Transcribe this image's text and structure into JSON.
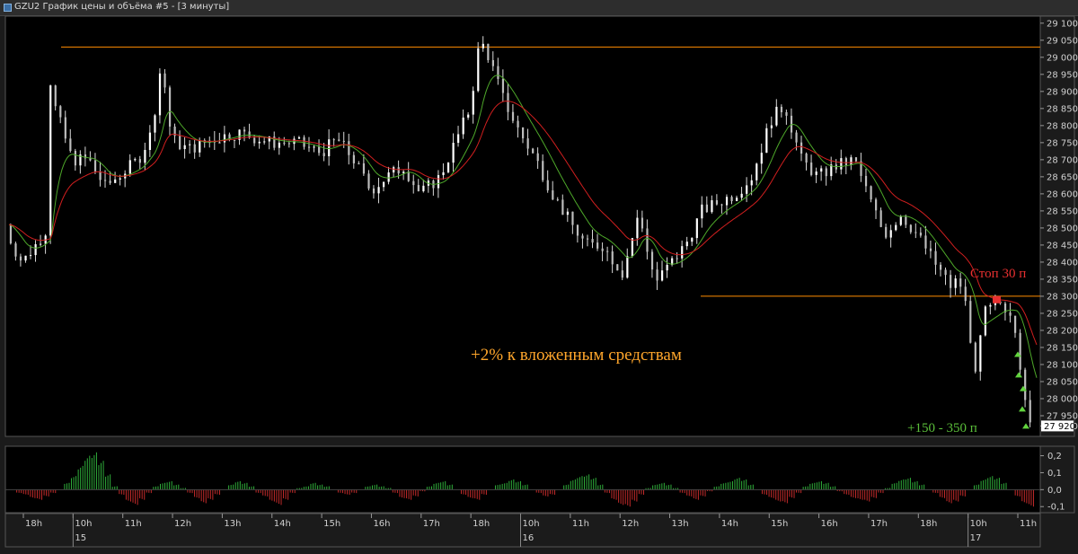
{
  "window": {
    "title": "GZU2 График цены и объёма #5 - [3 минуты]"
  },
  "chart_data": [
    {
      "type": "candlestick",
      "ylim": [
        27900,
        29110
      ],
      "y_ticks": [
        "29 100",
        "29 050",
        "29 000",
        "28 950",
        "28 900",
        "28 850",
        "28 800",
        "28 750",
        "28 700",
        "28 650",
        "28 600",
        "28 550",
        "28 500",
        "28 450",
        "28 400",
        "28 350",
        "28 300",
        "28 250",
        "28 200",
        "28 150",
        "28 100",
        "28 050",
        "28 000",
        "27 950",
        "27 920"
      ],
      "current_price_label": "27 920",
      "x_ticks": [
        "18h",
        "10h",
        "11h",
        "12h",
        "13h",
        "14h",
        "15h",
        "16h",
        "17h",
        "18h",
        "10h",
        "11h",
        "12h",
        "13h",
        "14h",
        "15h",
        "16h",
        "17h",
        "18h",
        "10h",
        "11h"
      ],
      "date_labels": [
        {
          "text": "15",
          "at": "10h"
        },
        {
          "text": "16",
          "at": "10h"
        },
        {
          "text": "17",
          "at": "10h"
        }
      ],
      "price_path": [
        [
          0,
          28510
        ],
        [
          4,
          28450
        ],
        [
          10,
          28400
        ],
        [
          18,
          28450
        ],
        [
          25,
          28500
        ],
        [
          27,
          28930
        ],
        [
          30,
          28850
        ],
        [
          40,
          28700
        ],
        [
          50,
          28700
        ],
        [
          60,
          28620
        ],
        [
          70,
          28660
        ],
        [
          80,
          28700
        ],
        [
          88,
          28780
        ],
        [
          94,
          28990
        ],
        [
          100,
          28760
        ],
        [
          110,
          28730
        ],
        [
          125,
          28760
        ],
        [
          140,
          28780
        ],
        [
          160,
          28750
        ],
        [
          175,
          28750
        ],
        [
          190,
          28720
        ],
        [
          200,
          28760
        ],
        [
          210,
          28700
        ],
        [
          220,
          28610
        ],
        [
          230,
          28650
        ],
        [
          240,
          28680
        ],
        [
          250,
          28600
        ],
        [
          262,
          28650
        ],
        [
          272,
          28760
        ],
        [
          280,
          28850
        ],
        [
          286,
          29050
        ],
        [
          290,
          29020
        ],
        [
          300,
          28880
        ],
        [
          310,
          28780
        ],
        [
          320,
          28700
        ],
        [
          330,
          28600
        ],
        [
          340,
          28520
        ],
        [
          350,
          28450
        ],
        [
          360,
          28450
        ],
        [
          372,
          28370
        ],
        [
          382,
          28540
        ],
        [
          392,
          28340
        ],
        [
          410,
          28450
        ],
        [
          420,
          28550
        ],
        [
          440,
          28600
        ],
        [
          450,
          28650
        ],
        [
          462,
          28820
        ],
        [
          470,
          28860
        ],
        [
          480,
          28700
        ],
        [
          490,
          28650
        ],
        [
          500,
          28680
        ],
        [
          512,
          28700
        ],
        [
          520,
          28600
        ],
        [
          530,
          28480
        ],
        [
          540,
          28540
        ],
        [
          550,
          28480
        ],
        [
          560,
          28400
        ],
        [
          570,
          28330
        ],
        [
          575,
          28350
        ],
        [
          580,
          28260
        ],
        [
          585,
          28060
        ],
        [
          590,
          28250
        ],
        [
          600,
          28280
        ],
        [
          608,
          28250
        ],
        [
          612,
          28100
        ],
        [
          616,
          27940
        ],
        [
          618,
          27920
        ]
      ],
      "overlays": [
        {
          "name": "",
          "color": "#ff8c00",
          "price": 29030,
          "style": "horizontal-level"
        },
        {
          "name": "",
          "color": "#ff8c00",
          "price": 28300,
          "style": "horizontal-level"
        },
        {
          "name": "",
          "color": "#4ea82a",
          "style": "moving-average-fast"
        },
        {
          "name": "",
          "color": "#d11f1f",
          "style": "moving-average-slow"
        }
      ],
      "annotations": [
        {
          "text": "Стоп 30 п",
          "color": "#e83030"
        },
        {
          "text": "+2% к вложенным средствам",
          "color": "#ffa62b"
        },
        {
          "text": "+150 - 350 п",
          "color": "#5bbf3a"
        }
      ],
      "stop_marker": {
        "price": 28290,
        "color": "#e83030"
      },
      "take_profit_markers": [
        28130,
        28070,
        28030,
        27970,
        27920
      ]
    },
    {
      "type": "bar",
      "name": "",
      "ylim": [
        -0.12,
        0.24
      ],
      "y_ticks": [
        "0,2",
        "0,1",
        "0,0",
        "-0,1"
      ],
      "values": [
        0.0,
        -0.02,
        -0.03,
        -0.05,
        -0.06,
        -0.04,
        -0.02,
        0.0,
        0.04,
        0.08,
        0.14,
        0.2,
        0.22,
        0.17,
        0.09,
        0.02,
        -0.03,
        -0.07,
        -0.09,
        -0.06,
        -0.02,
        0.02,
        0.04,
        0.05,
        0.03,
        0.01,
        -0.02,
        -0.05,
        -0.08,
        -0.06,
        -0.03,
        0.0,
        0.03,
        0.05,
        0.04,
        0.02,
        -0.02,
        -0.04,
        -0.07,
        -0.09,
        -0.06,
        -0.02,
        0.01,
        0.02,
        0.04,
        0.03,
        0.02,
        0.0,
        -0.02,
        -0.03,
        -0.02,
        0.0,
        0.02,
        0.03,
        0.02,
        0.01,
        -0.02,
        -0.05,
        -0.06,
        -0.04,
        -0.01,
        0.02,
        0.04,
        0.05,
        0.03,
        0.0,
        -0.03,
        -0.05,
        -0.06,
        -0.03,
        0.0,
        0.03,
        0.04,
        0.06,
        0.05,
        0.03,
        0.0,
        -0.02,
        -0.04,
        -0.03,
        0.0,
        0.03,
        0.06,
        0.08,
        0.09,
        0.07,
        0.03,
        -0.02,
        -0.06,
        -0.09,
        -0.1,
        -0.07,
        -0.03,
        0.01,
        0.03,
        0.04,
        0.03,
        0.01,
        -0.02,
        -0.04,
        -0.06,
        -0.04,
        -0.01,
        0.02,
        0.04,
        0.05,
        0.07,
        0.06,
        0.03,
        0.0,
        -0.03,
        -0.05,
        -0.07,
        -0.08,
        -0.05,
        -0.02,
        0.02,
        0.04,
        0.05,
        0.04,
        0.02,
        -0.01,
        -0.03,
        -0.05,
        -0.06,
        -0.07,
        -0.05,
        -0.02,
        0.01,
        0.04,
        0.06,
        0.07,
        0.05,
        0.03,
        0.0,
        -0.02,
        -0.05,
        -0.08,
        -0.07,
        -0.04,
        0.0,
        0.03,
        0.06,
        0.08,
        0.07,
        0.04,
        0.0,
        -0.04,
        -0.08,
        -0.1
      ]
    }
  ]
}
